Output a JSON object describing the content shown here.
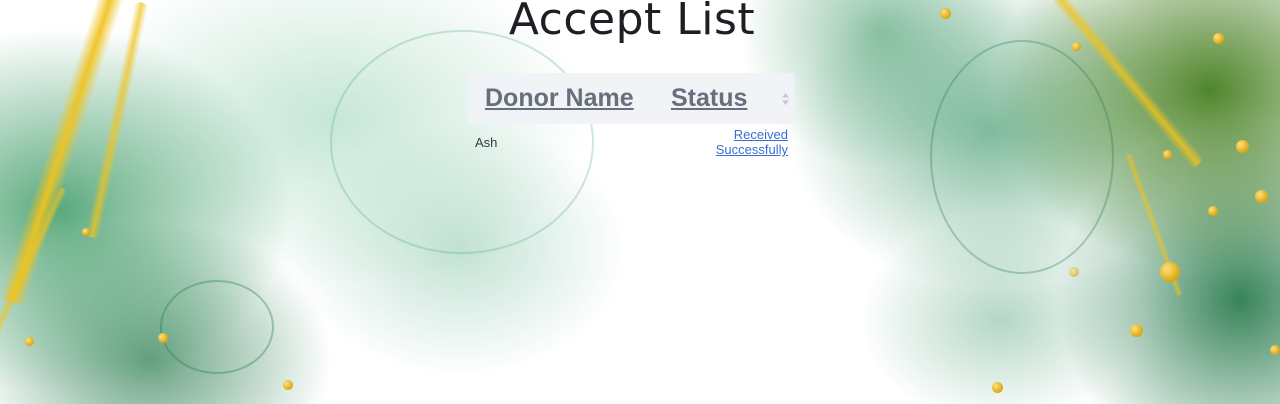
{
  "page": {
    "title": "Accept List"
  },
  "table": {
    "columns": [
      {
        "label": "Donor Name",
        "sortable": false
      },
      {
        "label": "Status",
        "sortable": true
      }
    ],
    "rows": [
      {
        "donor_name": "Ash",
        "status": "Received Successfully"
      }
    ]
  },
  "icons": {
    "sort": "sort-arrows-icon"
  },
  "colors": {
    "title": "#1e1f24",
    "header_text": "#676f7c",
    "header_bg": "#f0f2f6",
    "link": "#3b6fd0",
    "accent_green": "#228c50",
    "accent_gold": "#e6b414"
  }
}
